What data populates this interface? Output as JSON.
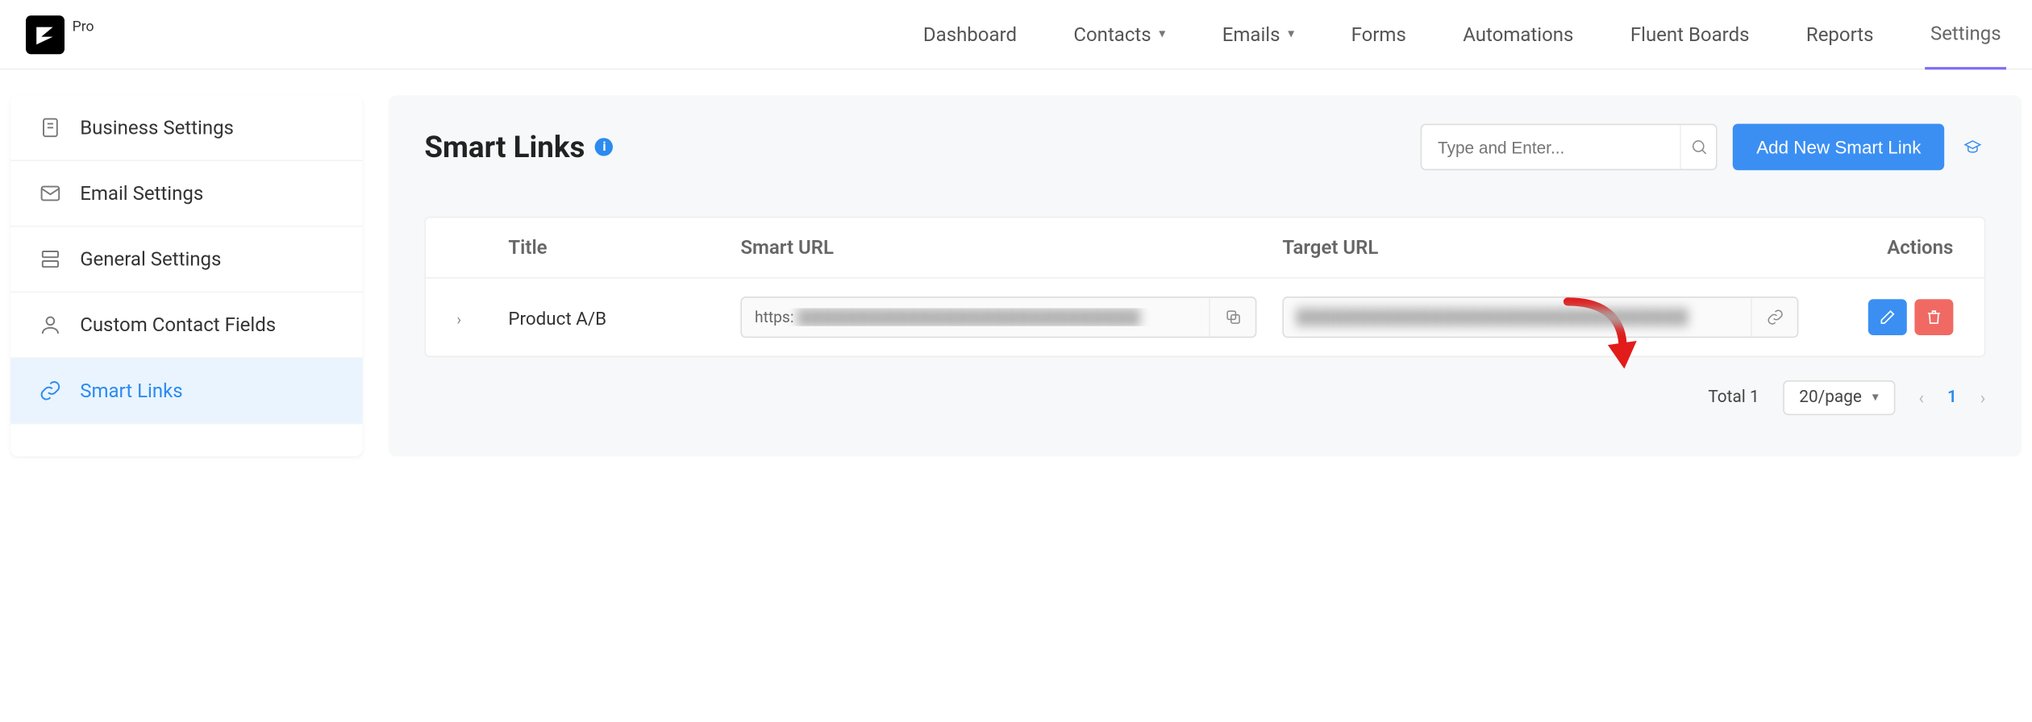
{
  "brand": {
    "pro_label": "Pro"
  },
  "nav": {
    "dashboard": "Dashboard",
    "contacts": "Contacts",
    "emails": "Emails",
    "forms": "Forms",
    "automations": "Automations",
    "fluent_boards": "Fluent Boards",
    "reports": "Reports",
    "settings": "Settings"
  },
  "sidebar": {
    "business": "Business Settings",
    "email": "Email Settings",
    "general": "General Settings",
    "contact_fields": "Custom Contact Fields",
    "smart_links": "Smart Links"
  },
  "page": {
    "title": "Smart Links",
    "info_symbol": "i",
    "search_placeholder": "Type and Enter...",
    "add_button": "Add New Smart Link"
  },
  "table": {
    "headers": {
      "title": "Title",
      "smart_url": "Smart URL",
      "target_url": "Target URL",
      "actions": "Actions"
    },
    "rows": [
      {
        "title": "Product A/B",
        "smart_url_prefix": "https:",
        "smart_url_hidden": "████████████████████████████",
        "target_url_hidden": "████████████████████████████████"
      }
    ]
  },
  "pagination": {
    "total_label": "Total 1",
    "page_size_label": "20/page",
    "current": "1"
  }
}
